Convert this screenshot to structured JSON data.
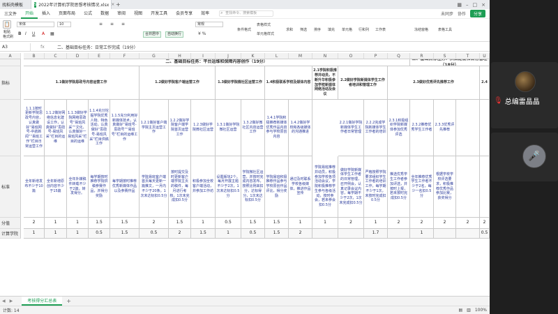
{
  "window": {
    "app_label": "找稻壳模板",
    "file_tab": "2022年计算机学院思想考核情况.xlsx",
    "logo_text": "S",
    "new_tab": "+",
    "close_tab": "×"
  },
  "menu": {
    "file": "三文件",
    "items": [
      "开始",
      "插入",
      "页面布局",
      "公式",
      "数据",
      "审阅",
      "视图",
      "开发工具",
      "会员专享",
      "效率"
    ],
    "active_index": 0,
    "search_placeholder": "查找命令、搜索模板",
    "sync": "未同步",
    "share": "分享",
    "collab": "协作"
  },
  "ribbon": {
    "paste": "粘贴",
    "format_painter": "格式刷",
    "font_name": "宋体",
    "font_size": "10",
    "bold": "B",
    "italic": "I",
    "underline": "U",
    "merge_center": "合并居中",
    "auto_wrap": "自动换行",
    "general": "常规",
    "table_style": "表格样式",
    "cond_format": "条件格式",
    "cell_style": "单元格样式",
    "sum": "求和",
    "filter": "筛选",
    "sort": "排序",
    "fill": "填充",
    "cell": "单元格",
    "row_col": "行和列",
    "worksheet": "工作表",
    "freeze": "冻结窗格",
    "table_tools": "表格工具"
  },
  "formula_bar": {
    "name_box": "A3",
    "fx": "fx",
    "content": "二、基础目标任务：日常工作完成（19分）"
  },
  "columns": [
    "A",
    "B",
    "C",
    "D",
    "E",
    "F",
    "G",
    "H",
    "I",
    "J",
    "K",
    "L",
    "M",
    "N",
    "O",
    "P",
    "Q",
    "R",
    "S",
    "T",
    "U"
  ],
  "rows": {
    "r3_label": "",
    "r4_label": "指标",
    "r5_label": "",
    "r6_label": "标准",
    "r7_label": "分值",
    "r8_label": "计算学院"
  },
  "sheet": {
    "section_title": "二、基础目标任务：平台运维和保障内容创作（19分）",
    "section_title_right": "三、基础目标任务：队伍建设和日常管理（18分）",
    "group1": "1.1做好学院思政号内容运营工作",
    "group2": "1.2做好学院客户端运营工作",
    "group3": "1.3做好学院微社区运营工作",
    "group4": "1.4积极联系学校及媒体内容",
    "group5": "2.1学院积极推荐并动员，不断升华积极参加学校新媒体网络活动及会议",
    "group6": "2.2做好学院新媒体学生工作者培训和管理工作",
    "group7": "2.3做好优秀评先推荐工作",
    "group8": "2.4",
    "sub": [
      "1.1.1按时更新学院思政号内容，认真做好“易班网号-中航新闻”“易班工作”栏目日常运营工作",
      "1.1.2做好网络信息化建设工作，认真做好“思政号-易班风采”栏目的运维",
      "1.1.3做好学院网络思政号“易班风采”“文化、认真做好一易班风采”栏目的运维",
      "1.1.4充分挖掘学院优秀人物、特色活动，认真做好“思政号-易班风采”栏目供稿工作",
      "1.1.5充分利用好新媒体技术，认真做好“易班号-思政号”“易班号”栏目的运维工作",
      "1.2.1做好客户端学院主页运营工作",
      "1.2.2做好学院客户端学院首页运营工作",
      "1.2.3做好学院微社区运营",
      "1.3.1做好学院微社区运营",
      "1.3.2做好微社区内容运营工作",
      "1.4.1学院积极推荐新媒体优秀作品内容参与学校原创内容",
      "1.4.2做好学校和各级媒体的沟通推进",
      "",
      "2.2.1做好学院新媒体学生工作者日常管理",
      "2.2.2完成学院新媒体学生工作者的培训",
      "2.3.1积极组织学院新媒体参加优秀评选",
      "2.3.2推荐优秀学生工作者",
      "2.3.3优秀评先推荐"
    ],
    "std": [
      "全年新增发布不少于10篇",
      "全年新增原创内容不少于15篇",
      "全年外媒稿件转载不少于2篇，转发得分。",
      "每学期按时推荐学院供稿参赛作品，并得分奖励",
      "每学期按时推荐优秀新媒体作品以及参赛作品",
      "学院易班客户端首页每天更新一篇推文，一月内不少于20条，1次未达标扣0.5分",
      "按时提交及时更新客户端学院主页的稿件，每月进行考核，1次未完成扣0.5分",
      "积极参加全校客户端活动，并参加工作坊",
      "设置版块2个，每月开展主题不少于2次，1次未达标扣0.5分",
      "学院微社区运营，并按时完成内容发布，按照比例来扣分，达标得分，1次未达标扣0.5分",
      "学院易班积极推荐作品参与学校原创作品评比，得分奖励",
      "通过及时联系学校各级媒体，推进作品宣传",
      "学院易班推荐并动员，积极参加学校各项活动会议，学院积极推荐学生参与各级活动，按时参会，若未参会扣0.5分",
      "做好学院新媒体学生工作者的日常管理，召开例会，认真记录会议内容，每学期不少于2次，1次未完成扣0.5分",
      "严格按照学院要求组织学生工作者的培训工作，每学期不少于1次，未按时完成扣0.5分",
      "推选优秀学生工作者参加评选，并按时上报，若未按时完成扣0.5分",
      "全年推荐优秀学生工作者不少于2名，每少一名扣0.5分",
      "根据学校学校评选要求，积极推荐优秀作品参加比赛，获奖得分"
    ],
    "scores": [
      "2",
      "1",
      "1",
      "1.5",
      "1.5",
      "2",
      "1.5",
      "1",
      "0.5",
      "1.5",
      "1.5",
      "1",
      "1",
      "2",
      "1",
      "2",
      "2",
      "2",
      "2",
      "2"
    ],
    "row8": [
      "1",
      "1",
      "1",
      "0.5",
      "1.5",
      "0.5",
      "2",
      "1.5",
      "1",
      "0.5",
      "1.5",
      "2",
      "",
      "",
      "1.7",
      "",
      "1",
      "",
      "",
      "0.5"
    ]
  },
  "bottom": {
    "sheet_tab": "考核得分汇总表",
    "add": "+",
    "status_left": "计数: 14",
    "zoom": "100%"
  },
  "meeting": {
    "speaker_name": "总编雷晶晶"
  }
}
